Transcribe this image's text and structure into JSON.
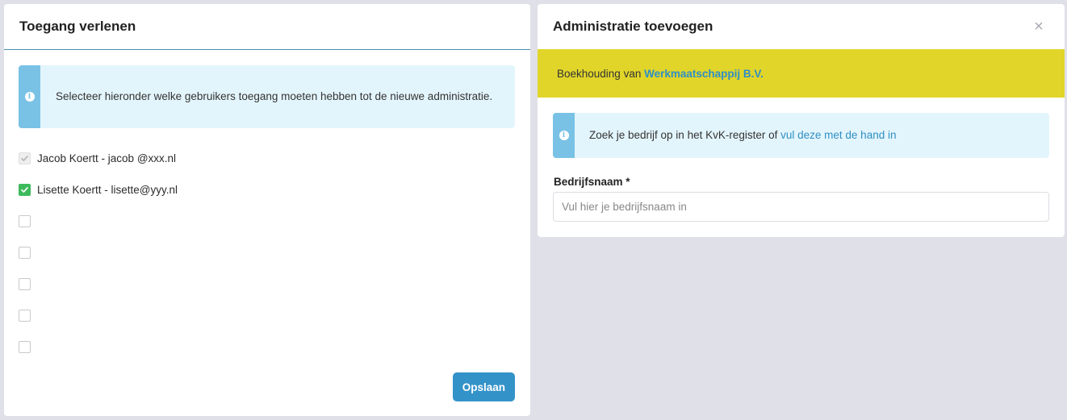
{
  "left_panel": {
    "title": "Toegang verlenen",
    "info_text": "Selecteer hieronder welke gebruikers toegang moeten hebben tot de nieuwe administratie.",
    "users": [
      {
        "label": "Jacob Koertt - jacob @xxx.nl",
        "state": "checked-disabled"
      },
      {
        "label": "Lisette Koertt - lisette@yyy.nl",
        "state": "checked"
      },
      {
        "label": "",
        "state": "unchecked"
      },
      {
        "label": "",
        "state": "unchecked"
      },
      {
        "label": "",
        "state": "unchecked"
      },
      {
        "label": "",
        "state": "unchecked"
      },
      {
        "label": "",
        "state": "unchecked"
      }
    ],
    "save_label": "Opslaan"
  },
  "right_panel": {
    "title": "Administratie toevoegen",
    "close_symbol": "×",
    "banner_prefix": "Boekhouding van ",
    "banner_company": "Werkmaatschappij B.V.",
    "info_prefix": "Zoek je bedrijf op in het KvK-register of ",
    "info_link": "vul deze met de hand in",
    "field_label": "Bedrijfsnaam *",
    "field_placeholder": "Vul hier je bedrijfsnaam in",
    "field_value": ""
  },
  "colors": {
    "accent": "#3393c8",
    "banner": "#e1d52a",
    "info_bg": "#e3f5fc",
    "info_strip": "#79c2e6",
    "check_green": "#3dbb5c",
    "page_bg": "#dfe0e8"
  },
  "icons": {
    "info": "info-icon",
    "close": "close-icon",
    "check": "check-icon"
  }
}
